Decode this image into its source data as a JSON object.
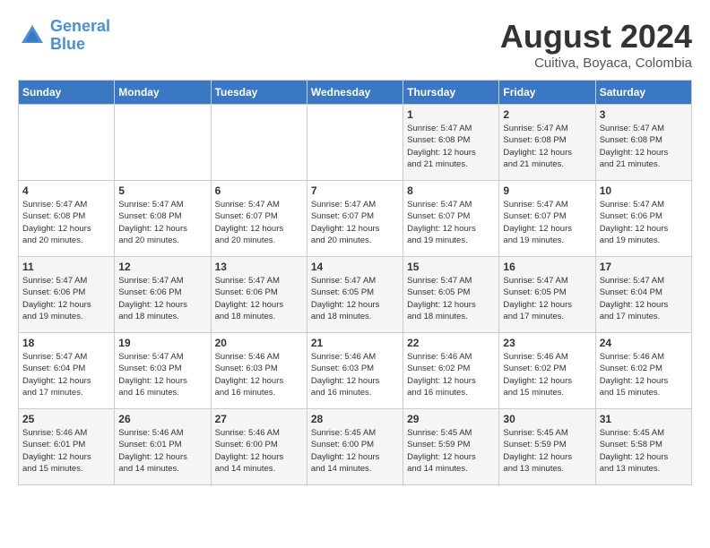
{
  "header": {
    "logo_line1": "General",
    "logo_line2": "Blue",
    "month_year": "August 2024",
    "location": "Cuitiva, Boyaca, Colombia"
  },
  "days_of_week": [
    "Sunday",
    "Monday",
    "Tuesday",
    "Wednesday",
    "Thursday",
    "Friday",
    "Saturday"
  ],
  "weeks": [
    [
      {
        "day": "",
        "info": ""
      },
      {
        "day": "",
        "info": ""
      },
      {
        "day": "",
        "info": ""
      },
      {
        "day": "",
        "info": ""
      },
      {
        "day": "1",
        "info": "Sunrise: 5:47 AM\nSunset: 6:08 PM\nDaylight: 12 hours\nand 21 minutes."
      },
      {
        "day": "2",
        "info": "Sunrise: 5:47 AM\nSunset: 6:08 PM\nDaylight: 12 hours\nand 21 minutes."
      },
      {
        "day": "3",
        "info": "Sunrise: 5:47 AM\nSunset: 6:08 PM\nDaylight: 12 hours\nand 21 minutes."
      }
    ],
    [
      {
        "day": "4",
        "info": "Sunrise: 5:47 AM\nSunset: 6:08 PM\nDaylight: 12 hours\nand 20 minutes."
      },
      {
        "day": "5",
        "info": "Sunrise: 5:47 AM\nSunset: 6:08 PM\nDaylight: 12 hours\nand 20 minutes."
      },
      {
        "day": "6",
        "info": "Sunrise: 5:47 AM\nSunset: 6:07 PM\nDaylight: 12 hours\nand 20 minutes."
      },
      {
        "day": "7",
        "info": "Sunrise: 5:47 AM\nSunset: 6:07 PM\nDaylight: 12 hours\nand 20 minutes."
      },
      {
        "day": "8",
        "info": "Sunrise: 5:47 AM\nSunset: 6:07 PM\nDaylight: 12 hours\nand 19 minutes."
      },
      {
        "day": "9",
        "info": "Sunrise: 5:47 AM\nSunset: 6:07 PM\nDaylight: 12 hours\nand 19 minutes."
      },
      {
        "day": "10",
        "info": "Sunrise: 5:47 AM\nSunset: 6:06 PM\nDaylight: 12 hours\nand 19 minutes."
      }
    ],
    [
      {
        "day": "11",
        "info": "Sunrise: 5:47 AM\nSunset: 6:06 PM\nDaylight: 12 hours\nand 19 minutes."
      },
      {
        "day": "12",
        "info": "Sunrise: 5:47 AM\nSunset: 6:06 PM\nDaylight: 12 hours\nand 18 minutes."
      },
      {
        "day": "13",
        "info": "Sunrise: 5:47 AM\nSunset: 6:06 PM\nDaylight: 12 hours\nand 18 minutes."
      },
      {
        "day": "14",
        "info": "Sunrise: 5:47 AM\nSunset: 6:05 PM\nDaylight: 12 hours\nand 18 minutes."
      },
      {
        "day": "15",
        "info": "Sunrise: 5:47 AM\nSunset: 6:05 PM\nDaylight: 12 hours\nand 18 minutes."
      },
      {
        "day": "16",
        "info": "Sunrise: 5:47 AM\nSunset: 6:05 PM\nDaylight: 12 hours\nand 17 minutes."
      },
      {
        "day": "17",
        "info": "Sunrise: 5:47 AM\nSunset: 6:04 PM\nDaylight: 12 hours\nand 17 minutes."
      }
    ],
    [
      {
        "day": "18",
        "info": "Sunrise: 5:47 AM\nSunset: 6:04 PM\nDaylight: 12 hours\nand 17 minutes."
      },
      {
        "day": "19",
        "info": "Sunrise: 5:47 AM\nSunset: 6:03 PM\nDaylight: 12 hours\nand 16 minutes."
      },
      {
        "day": "20",
        "info": "Sunrise: 5:46 AM\nSunset: 6:03 PM\nDaylight: 12 hours\nand 16 minutes."
      },
      {
        "day": "21",
        "info": "Sunrise: 5:46 AM\nSunset: 6:03 PM\nDaylight: 12 hours\nand 16 minutes."
      },
      {
        "day": "22",
        "info": "Sunrise: 5:46 AM\nSunset: 6:02 PM\nDaylight: 12 hours\nand 16 minutes."
      },
      {
        "day": "23",
        "info": "Sunrise: 5:46 AM\nSunset: 6:02 PM\nDaylight: 12 hours\nand 15 minutes."
      },
      {
        "day": "24",
        "info": "Sunrise: 5:46 AM\nSunset: 6:02 PM\nDaylight: 12 hours\nand 15 minutes."
      }
    ],
    [
      {
        "day": "25",
        "info": "Sunrise: 5:46 AM\nSunset: 6:01 PM\nDaylight: 12 hours\nand 15 minutes."
      },
      {
        "day": "26",
        "info": "Sunrise: 5:46 AM\nSunset: 6:01 PM\nDaylight: 12 hours\nand 14 minutes."
      },
      {
        "day": "27",
        "info": "Sunrise: 5:46 AM\nSunset: 6:00 PM\nDaylight: 12 hours\nand 14 minutes."
      },
      {
        "day": "28",
        "info": "Sunrise: 5:45 AM\nSunset: 6:00 PM\nDaylight: 12 hours\nand 14 minutes."
      },
      {
        "day": "29",
        "info": "Sunrise: 5:45 AM\nSunset: 5:59 PM\nDaylight: 12 hours\nand 14 minutes."
      },
      {
        "day": "30",
        "info": "Sunrise: 5:45 AM\nSunset: 5:59 PM\nDaylight: 12 hours\nand 13 minutes."
      },
      {
        "day": "31",
        "info": "Sunrise: 5:45 AM\nSunset: 5:58 PM\nDaylight: 12 hours\nand 13 minutes."
      }
    ]
  ]
}
